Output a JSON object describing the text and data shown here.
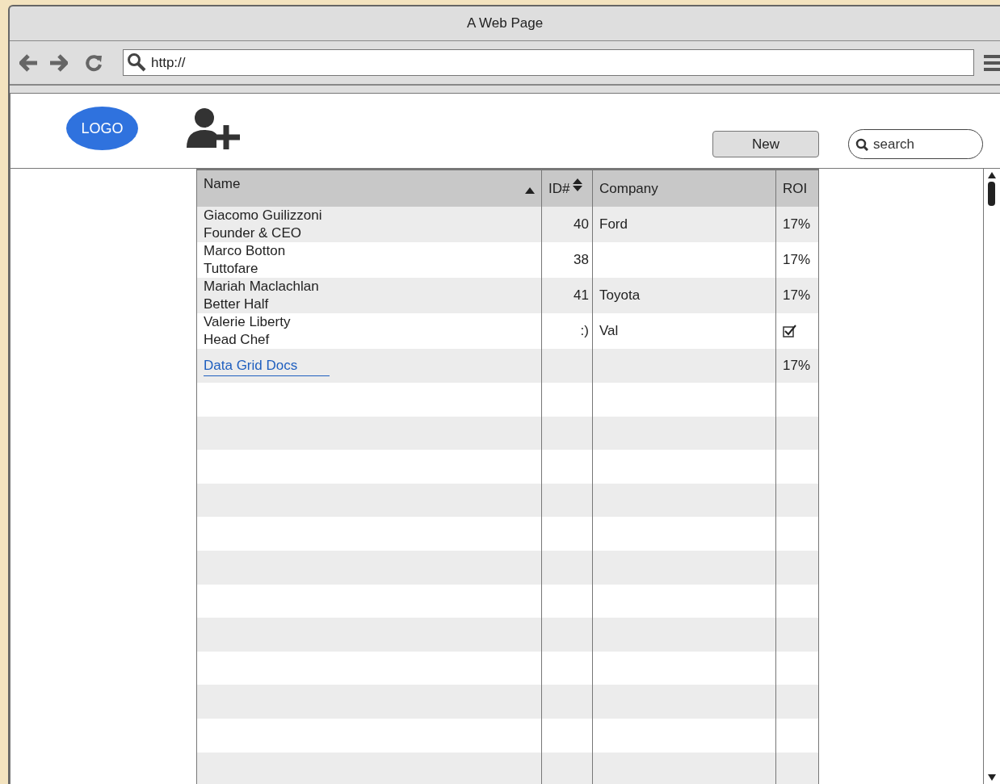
{
  "window": {
    "title": "A Web Page"
  },
  "address_bar": {
    "value": "http://"
  },
  "header": {
    "logo": "LOGO",
    "new_button": "New",
    "search": {
      "placeholder": "search"
    }
  },
  "table": {
    "columns": [
      {
        "label": "Name",
        "sorted": true,
        "sortable": true
      },
      {
        "label": "ID#",
        "sorted": false,
        "sortable": true
      },
      {
        "label": "Company",
        "sorted": false,
        "sortable": false
      },
      {
        "label": "ROI",
        "sorted": false,
        "sortable": false
      }
    ],
    "rows": [
      {
        "kind": "person",
        "name": "Giacomo Guilizzoni",
        "role": "Founder & CEO",
        "id": "40",
        "company": "Ford",
        "roi": {
          "kind": "text",
          "text": "17%"
        }
      },
      {
        "kind": "person",
        "name": "Marco Botton",
        "role": "Tuttofare",
        "id": "38",
        "roi": {
          "kind": "text",
          "text": "17%"
        }
      },
      {
        "kind": "person",
        "name": "Mariah Maclachlan",
        "role": "Better Half",
        "id": "41",
        "company": "Toyota",
        "roi": {
          "kind": "text",
          "text": "17%"
        }
      },
      {
        "kind": "person",
        "name": "Valerie Liberty",
        "role": "Head Chef",
        "id": ":)",
        "company": "Val",
        "roi": {
          "kind": "checkbox",
          "checked": true
        }
      },
      {
        "kind": "link",
        "link": "Data Grid Docs",
        "roi": {
          "kind": "text",
          "text": "17%"
        }
      }
    ]
  }
}
